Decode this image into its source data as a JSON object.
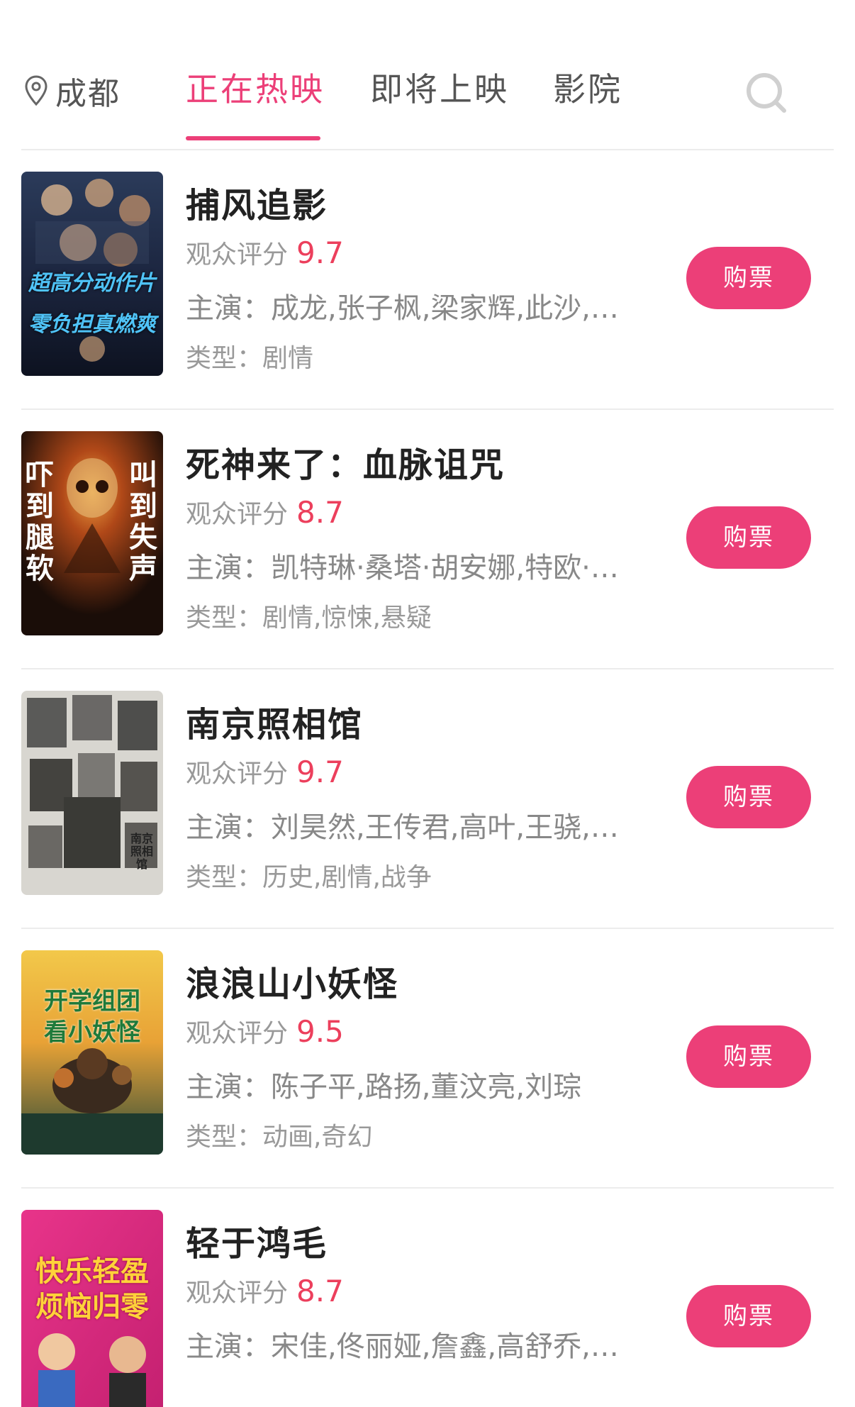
{
  "header": {
    "city": "成都",
    "tabs": [
      {
        "label": "正在热映",
        "active": true
      },
      {
        "label": "即将上映",
        "active": false
      },
      {
        "label": "影院",
        "active": false
      }
    ],
    "accent_color": "#ec3f78"
  },
  "labels": {
    "rating_prefix": "观众评分",
    "cast_prefix": "主演：",
    "genre_prefix": "类型：",
    "buy": "购票"
  },
  "movies": [
    {
      "title": "捕风追影",
      "score": "9.7",
      "cast": "成龙,张子枫,梁家辉,此沙,…",
      "genre": "剧情",
      "poster": {
        "lines": [
          "超高分动作片",
          "零负担真燃爽"
        ]
      }
    },
    {
      "title": "死神来了：血脉诅咒",
      "score": "8.7",
      "cast": "凯特琳·桑塔·胡安娜,特欧·…",
      "genre": "剧情,惊悚,悬疑",
      "poster": {
        "lines": [
          "吓到腿软",
          "叫到失声"
        ]
      }
    },
    {
      "title": "南京照相馆",
      "score": "9.7",
      "cast": "刘昊然,王传君,高叶,王骁,…",
      "genre": "历史,剧情,战争",
      "poster": {
        "lines": [
          "南京照相馆"
        ]
      }
    },
    {
      "title": "浪浪山小妖怪",
      "score": "9.5",
      "cast": "陈子平,路扬,董汶亮,刘琮",
      "genre": "动画,奇幻",
      "poster": {
        "lines": [
          "开学组团",
          "看小妖怪"
        ]
      }
    },
    {
      "title": "轻于鸿毛",
      "score": "8.7",
      "cast": "宋佳,佟丽娅,詹鑫,高舒乔,…",
      "genre": "",
      "poster": {
        "lines": [
          "快乐轻盈",
          "烦恼归零"
        ]
      }
    }
  ]
}
